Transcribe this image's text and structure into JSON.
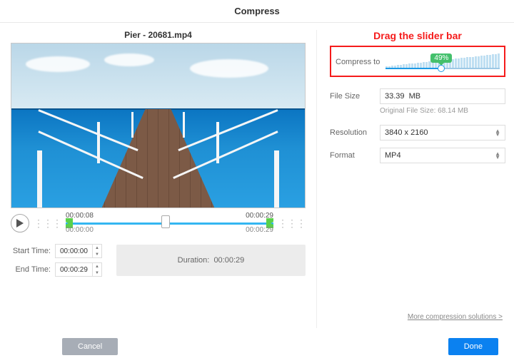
{
  "header": {
    "title": "Compress"
  },
  "video": {
    "title": "Pier - 20681.mp4"
  },
  "timeline": {
    "current": "00:00:08",
    "end": "00:00:29",
    "total_start": "00:00:00",
    "total_end": "00:00:29",
    "thumb_pos_pct": 48
  },
  "trim": {
    "start_label": "Start Time:",
    "end_label": "End Time:",
    "start_value": "00:00:00",
    "end_value": "00:00:29",
    "duration_label": "Duration:",
    "duration_value": "00:00:29"
  },
  "annotation": {
    "text": "Drag the slider bar"
  },
  "settings": {
    "compress_label": "Compress to",
    "compress_pct": 49,
    "compress_badge": "49%",
    "filesize_label": "File Size",
    "filesize_value": "33.39  MB",
    "original_label": "Original File Size: 68.14 MB",
    "resolution_label": "Resolution",
    "resolution_value": "3840 x 2160",
    "format_label": "Format",
    "format_value": "MP4"
  },
  "more_link": "More compression solutions >",
  "footer": {
    "cancel": "Cancel",
    "done": "Done"
  }
}
